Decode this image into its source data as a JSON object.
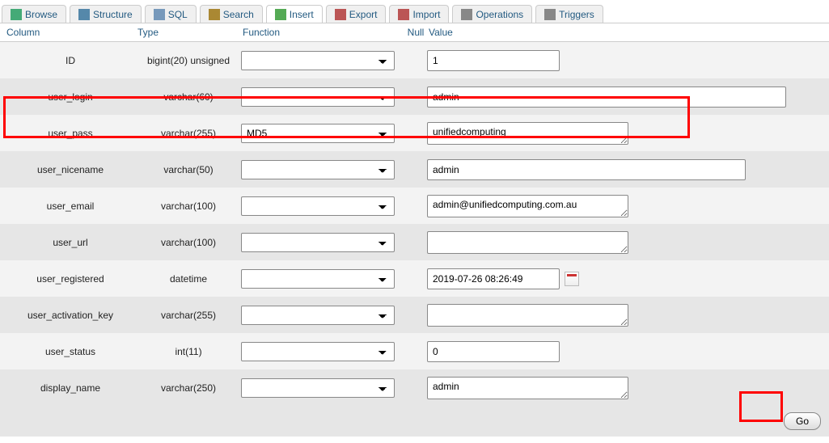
{
  "tabs": [
    {
      "label": "Browse",
      "icon": "#4a7",
      "active": false
    },
    {
      "label": "Structure",
      "icon": "#58a",
      "active": false
    },
    {
      "label": "SQL",
      "icon": "#79b",
      "active": false
    },
    {
      "label": "Search",
      "icon": "#a83",
      "active": false
    },
    {
      "label": "Insert",
      "icon": "#5a5",
      "active": true
    },
    {
      "label": "Export",
      "icon": "#b55",
      "active": false
    },
    {
      "label": "Import",
      "icon": "#b55",
      "active": false
    },
    {
      "label": "Operations",
      "icon": "#888",
      "active": false
    },
    {
      "label": "Triggers",
      "icon": "#888",
      "active": false
    }
  ],
  "headers": {
    "column": "Column",
    "type": "Type",
    "func": "Function",
    "null": "Null",
    "value": "Value"
  },
  "rows": [
    {
      "column": "ID",
      "type": "bigint(20) unsigned",
      "func": "",
      "value": "1",
      "widget": "input",
      "w": "w-s",
      "cal": false,
      "odd": true,
      "hl": false
    },
    {
      "column": "user_login",
      "type": "varchar(60)",
      "func": "",
      "value": "admin",
      "widget": "input",
      "w": "w-l",
      "cal": false,
      "odd": false,
      "hl": false
    },
    {
      "column": "user_pass",
      "type": "varchar(255)",
      "func": "MD5",
      "value": "unifiedcomputing",
      "widget": "textarea",
      "w": "w-m",
      "cal": false,
      "odd": true,
      "hl": true
    },
    {
      "column": "user_nicename",
      "type": "varchar(50)",
      "func": "",
      "value": "admin",
      "widget": "input",
      "w": "w-xl",
      "cal": false,
      "odd": false,
      "hl": false
    },
    {
      "column": "user_email",
      "type": "varchar(100)",
      "func": "",
      "value": "admin@unifiedcomputing.com.au",
      "widget": "textarea",
      "w": "w-m",
      "cal": false,
      "odd": true,
      "hl": false
    },
    {
      "column": "user_url",
      "type": "varchar(100)",
      "func": "",
      "value": "",
      "widget": "textarea",
      "w": "w-m",
      "cal": false,
      "odd": false,
      "hl": false
    },
    {
      "column": "user_registered",
      "type": "datetime",
      "func": "",
      "value": "2019-07-26 08:26:49",
      "widget": "input",
      "w": "w-s",
      "cal": true,
      "odd": true,
      "hl": false
    },
    {
      "column": "user_activation_key",
      "type": "varchar(255)",
      "func": "",
      "value": "",
      "widget": "textarea",
      "w": "w-m",
      "cal": false,
      "odd": false,
      "hl": false
    },
    {
      "column": "user_status",
      "type": "int(11)",
      "func": "",
      "value": "0",
      "widget": "input",
      "w": "w-s",
      "cal": false,
      "odd": true,
      "hl": false
    },
    {
      "column": "display_name",
      "type": "varchar(250)",
      "func": "",
      "value": "admin",
      "widget": "textarea",
      "w": "w-m",
      "cal": false,
      "odd": false,
      "hl": false
    }
  ],
  "footer": {
    "go": "Go"
  }
}
